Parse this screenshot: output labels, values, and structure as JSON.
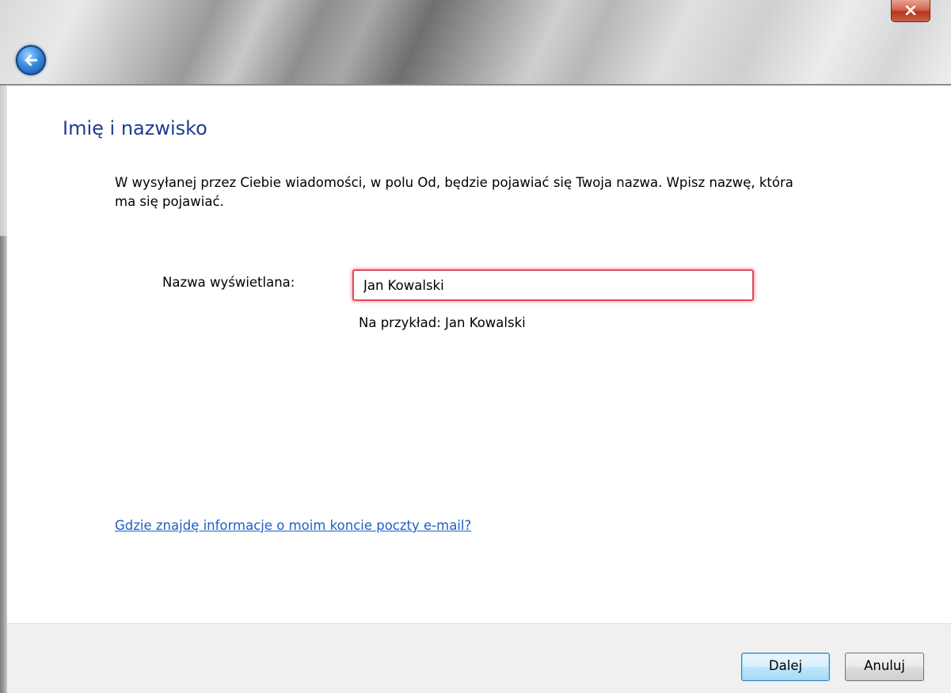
{
  "window": {
    "close_label": "x"
  },
  "page": {
    "title": "Imię i nazwisko",
    "description": "W wysyłanej przez Ciebie wiadomości, w polu Od, będzie pojawiać się Twoja nazwa. Wpisz nazwę, która ma się pojawiać."
  },
  "form": {
    "display_name_label": "Nazwa wyświetlana:",
    "display_name_value": "Jan Kowalski",
    "example_text": "Na przykład: Jan Kowalski"
  },
  "help": {
    "link_text": "Gdzie znajdę informacje o moim koncie poczty e-mail?"
  },
  "buttons": {
    "next_label": "Dalej",
    "cancel_label": "Anuluj"
  },
  "colors": {
    "title": "#1f3d8f",
    "link": "#1e5fc2",
    "input_focus_border": "#e1495b"
  },
  "icons": {
    "back": "back-arrow-icon",
    "close": "close-icon"
  }
}
